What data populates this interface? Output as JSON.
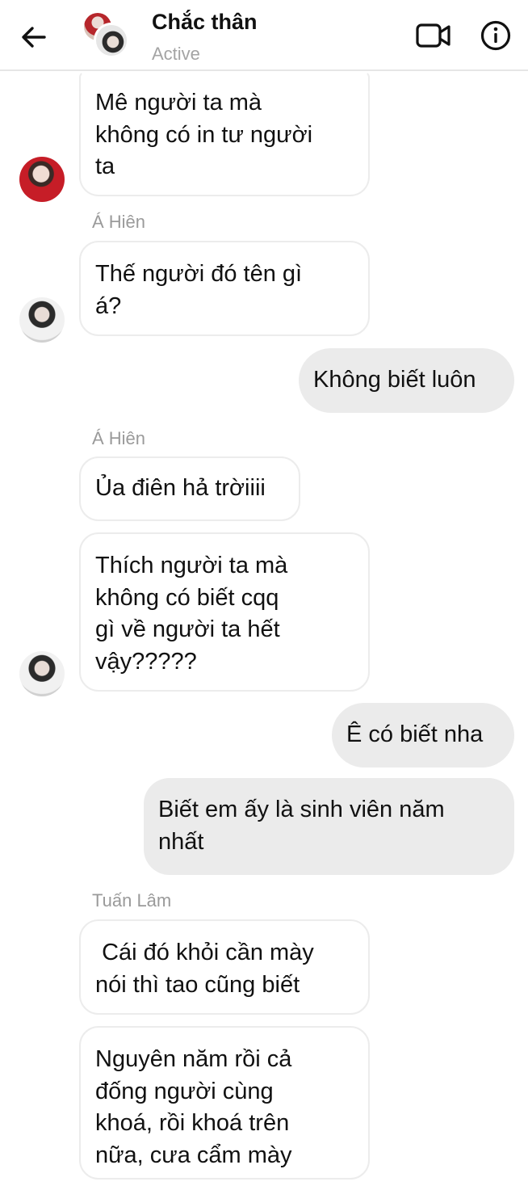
{
  "header": {
    "title": "Chắc thân",
    "status": "Active"
  },
  "messages": {
    "m1": "Mê người ta mà\nkhông có in tư người\nta",
    "sender1": "Á Hiên",
    "m2": "Thế người đó tên gì\ná?",
    "m3": "Không biết luôn",
    "sender2": "Á Hiên",
    "m4": "Ủa điên hả trờiiii",
    "m5": "Thích người ta mà\nkhông có biết cqq\ngì về người ta hết\nvậy?????",
    "m6": "Ê có biết nha",
    "m7": "Biết em ấy là sinh viên năm\nnhất",
    "sender3": "Tuấn Lâm",
    "m8": " Cái đó khỏi cần mày\nnói thì tao cũng biết",
    "m9": "Nguyên năm rồi cả\nđống người cùng\nkhoá, rồi khoá trên\nnữa, cưa cẩm mày"
  },
  "icons": {
    "back": "arrow-left-icon",
    "video": "video-camera-icon",
    "info": "info-icon"
  }
}
